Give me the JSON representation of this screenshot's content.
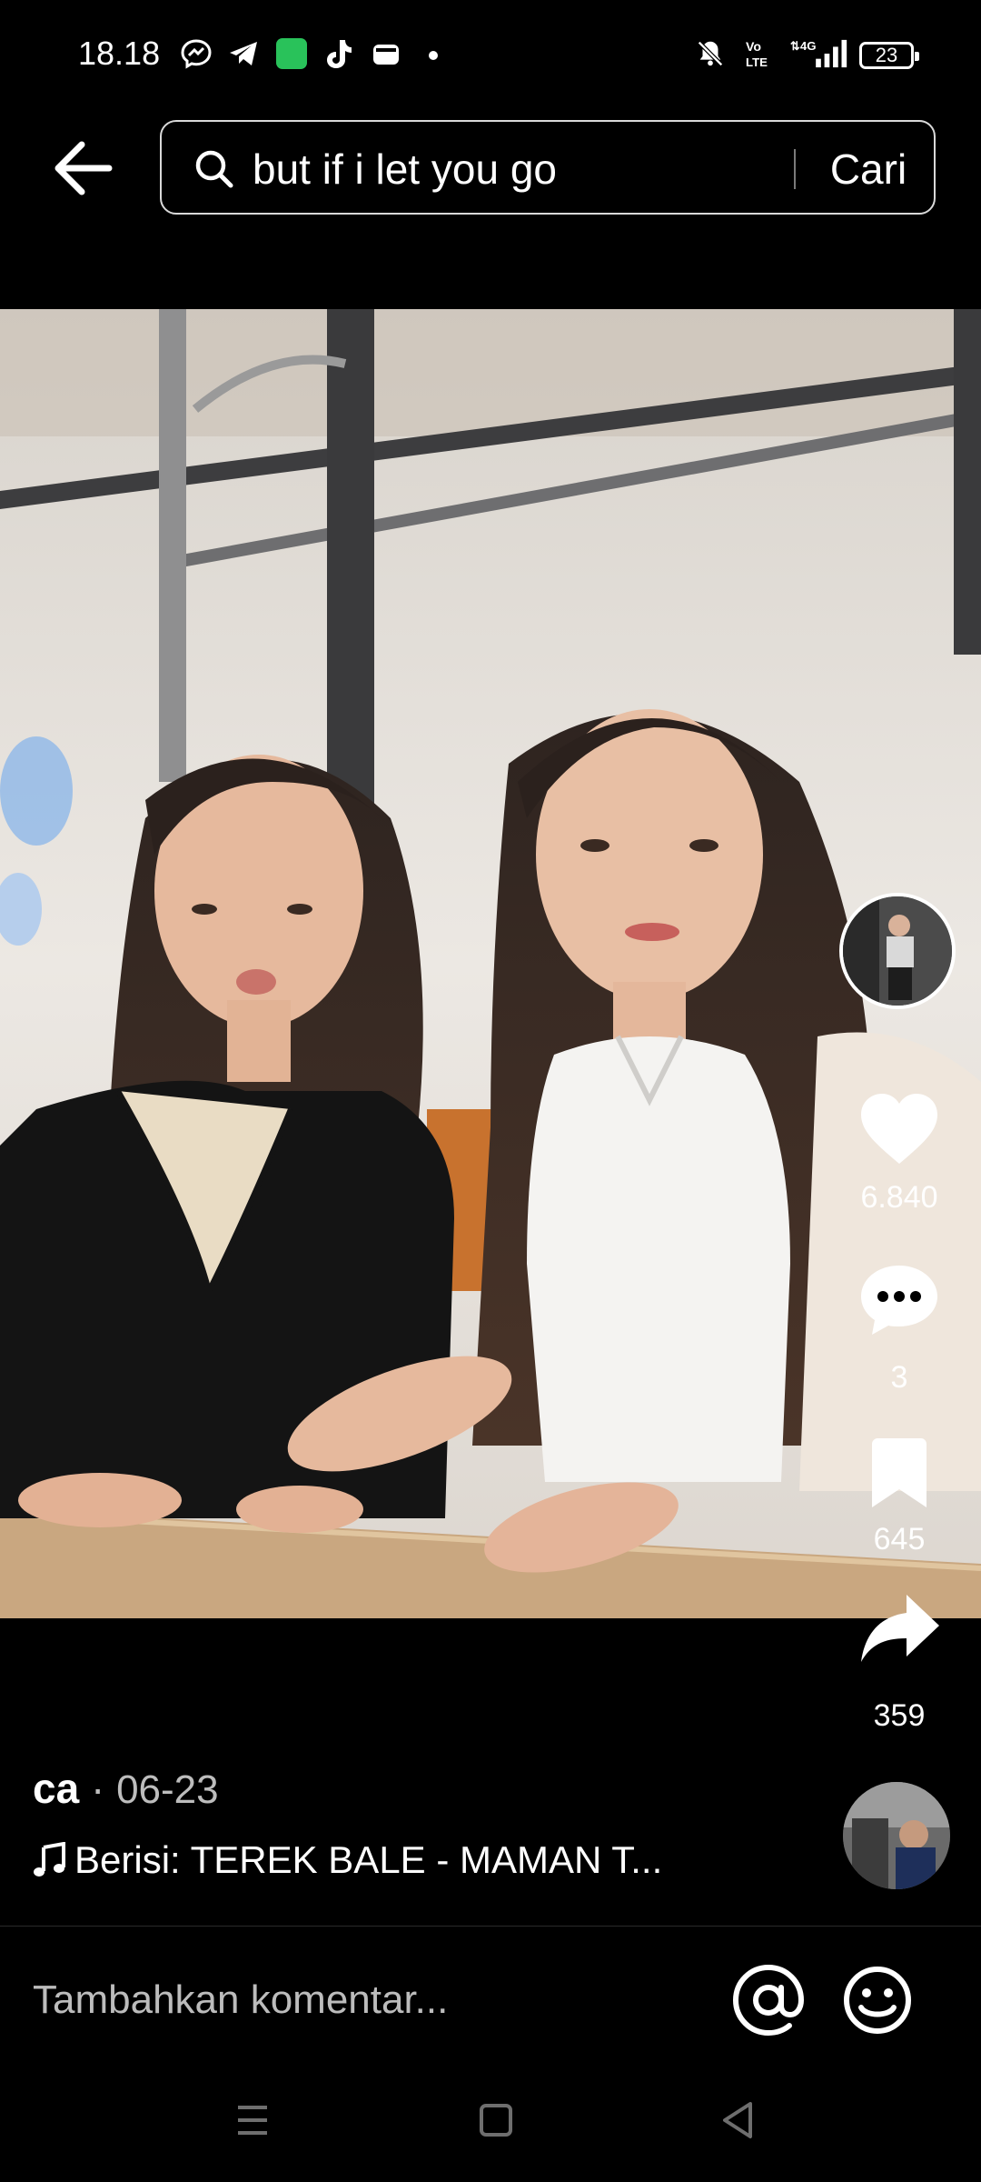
{
  "status_bar": {
    "time": "18.18",
    "battery": "23",
    "icons": [
      "messenger-icon",
      "telegram-icon",
      "app-icon",
      "tiktok-icon",
      "wallet-icon",
      "dot-icon",
      "mute-icon",
      "volte-icon",
      "4g-signal-icon",
      "battery-icon"
    ]
  },
  "search": {
    "query": "but if i let you go",
    "submit_label": "Cari"
  },
  "video": {
    "likes": "6.840",
    "comments": "3",
    "saves": "645",
    "shares": "359"
  },
  "caption": {
    "author": "ca",
    "separator": " · ",
    "date": "06-23",
    "music": "Berisi: TEREK BALE - MAMAN T..."
  },
  "comment_bar": {
    "placeholder": "Tambahkan komentar..."
  },
  "colors": {
    "background": "#000000",
    "text": "#ffffff",
    "muted": "#bdbdbd"
  }
}
